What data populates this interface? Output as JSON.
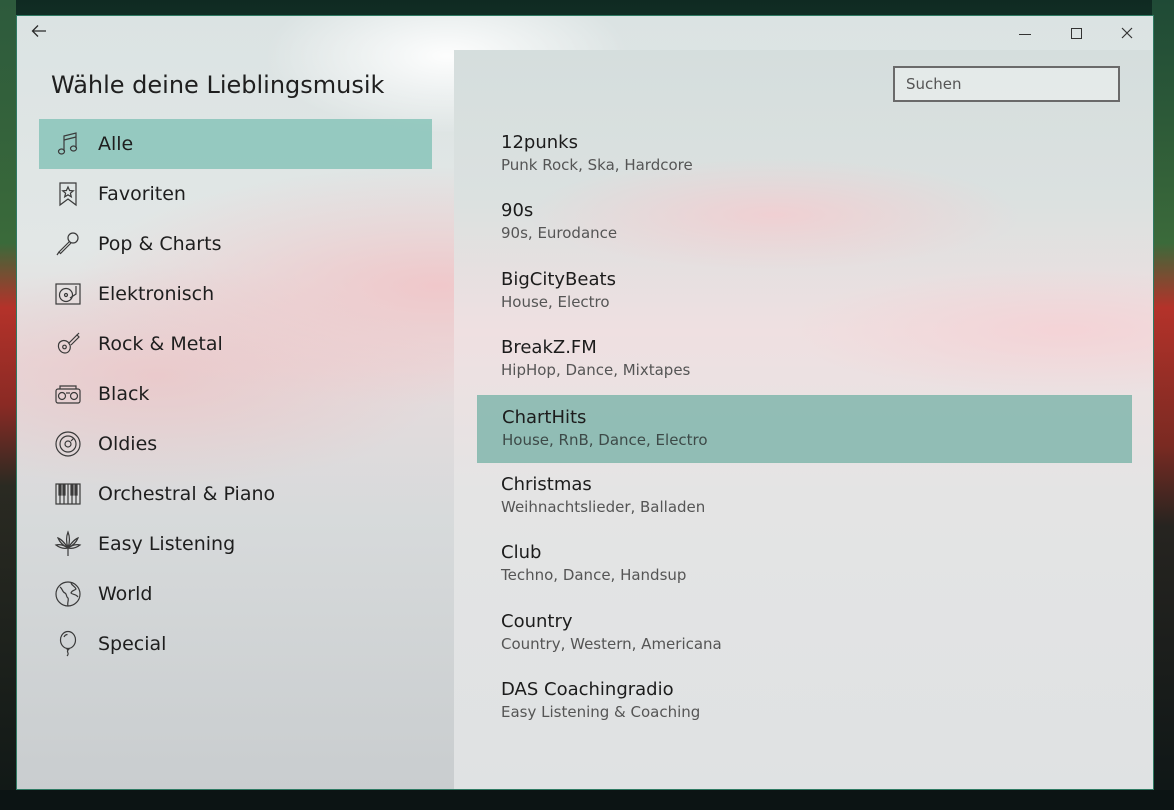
{
  "window": {
    "heading": "Wähle deine Lieblingsmusik",
    "back_icon": "arrow-left-icon",
    "caption_buttons": [
      "minimize",
      "maximize",
      "close"
    ]
  },
  "sidebar": {
    "items": [
      {
        "label": "Alle",
        "icon": "music-note-icon",
        "selected": true
      },
      {
        "label": "Favoriten",
        "icon": "star-bookmark-icon",
        "selected": false
      },
      {
        "label": "Pop & Charts",
        "icon": "microphone-icon",
        "selected": false
      },
      {
        "label": "Elektronisch",
        "icon": "turntable-icon",
        "selected": false
      },
      {
        "label": "Rock & Metal",
        "icon": "guitar-icon",
        "selected": false
      },
      {
        "label": "Black",
        "icon": "boombox-icon",
        "selected": false
      },
      {
        "label": "Oldies",
        "icon": "vinyl-record-icon",
        "selected": false
      },
      {
        "label": "Orchestral & Piano",
        "icon": "piano-keys-icon",
        "selected": false
      },
      {
        "label": "Easy Listening",
        "icon": "leaf-icon",
        "selected": false
      },
      {
        "label": "World",
        "icon": "globe-icon",
        "selected": false
      },
      {
        "label": "Special",
        "icon": "balloon-icon",
        "selected": false
      }
    ]
  },
  "search": {
    "placeholder": "Suchen",
    "value": ""
  },
  "stations": [
    {
      "name": "12punks",
      "genres": "Punk Rock, Ska, Hardcore",
      "selected": false
    },
    {
      "name": "90s",
      "genres": "90s, Eurodance",
      "selected": false
    },
    {
      "name": "BigCityBeats",
      "genres": "House, Electro",
      "selected": false
    },
    {
      "name": "BreakZ.FM",
      "genres": "HipHop, Dance, Mixtapes",
      "selected": false
    },
    {
      "name": "ChartHits",
      "genres": "House, RnB, Dance, Electro",
      "selected": true
    },
    {
      "name": "Christmas",
      "genres": "Weihnachtslieder, Balladen",
      "selected": false
    },
    {
      "name": "Club",
      "genres": "Techno, Dance, Handsup",
      "selected": false
    },
    {
      "name": "Country",
      "genres": "Country, Western, Americana",
      "selected": false
    },
    {
      "name": "DAS Coachingradio",
      "genres": "Easy Listening & Coaching",
      "selected": false
    }
  ],
  "colors": {
    "accent": "#78beb2",
    "selected_station": "#78b2a8",
    "window_border": "#2f7a63"
  }
}
